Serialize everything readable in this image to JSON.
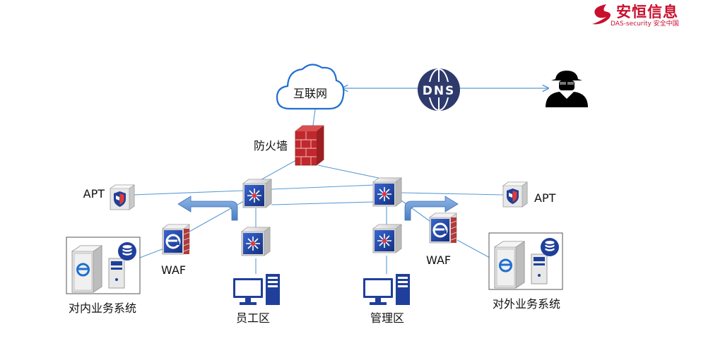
{
  "logo": {
    "name": "安恒信息",
    "tagline": "DAS-security 安全中国"
  },
  "dns": {
    "label": "DNS"
  },
  "labels": {
    "internet": "互联网",
    "firewall": "防火墙",
    "apt_left": "APT",
    "apt_right": "APT",
    "waf_left": "WAF",
    "waf_right": "WAF",
    "internal_system": "对内业务系统",
    "external_system": "对外业务系统",
    "staff_zone": "员工区",
    "mgmt_zone": "管理区"
  },
  "colors": {
    "line": "#5b9bd5",
    "switch": "#1f3f9b",
    "firewall_red": "#c0282d",
    "brand": "#c8102e",
    "dns": "#2d3a6b"
  }
}
